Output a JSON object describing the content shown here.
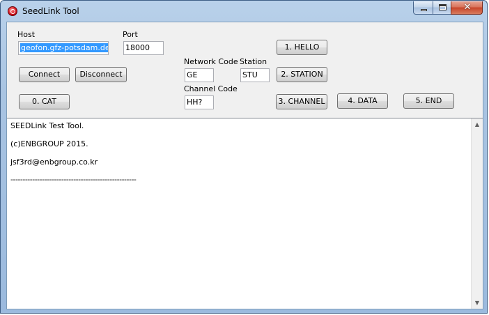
{
  "window": {
    "title": "SeedLink Tool",
    "close_glyph": "✕"
  },
  "form": {
    "host_label": "Host",
    "host_value": "geofon.gfz-potsdam.de",
    "port_label": "Port",
    "port_value": "18000",
    "network_label": "Network Code",
    "network_value": "GE",
    "station_label": "Station",
    "station_value": "STU",
    "channel_label": "Channel Code",
    "channel_value": "HH?"
  },
  "buttons": {
    "connect": "Connect",
    "disconnect": "Disconnect",
    "cat": "0. CAT",
    "hello": "1. HELLO",
    "station": "2. STATION",
    "channel": "3. CHANNEL",
    "data": "4. DATA",
    "end": "5. END"
  },
  "output": {
    "lines": [
      "SEEDLink Test Tool.",
      "(c)ENBGROUP 2015.",
      "jsf3rd@enbgroup.co.kr",
      "----------------------------------------------------"
    ]
  },
  "icons": {
    "app": "app-icon",
    "scroll_up": "▲",
    "scroll_down": "▼"
  },
  "colors": {
    "title_bar": "#a9c4e2",
    "close_button": "#c8452a",
    "selection": "#3399ff"
  }
}
